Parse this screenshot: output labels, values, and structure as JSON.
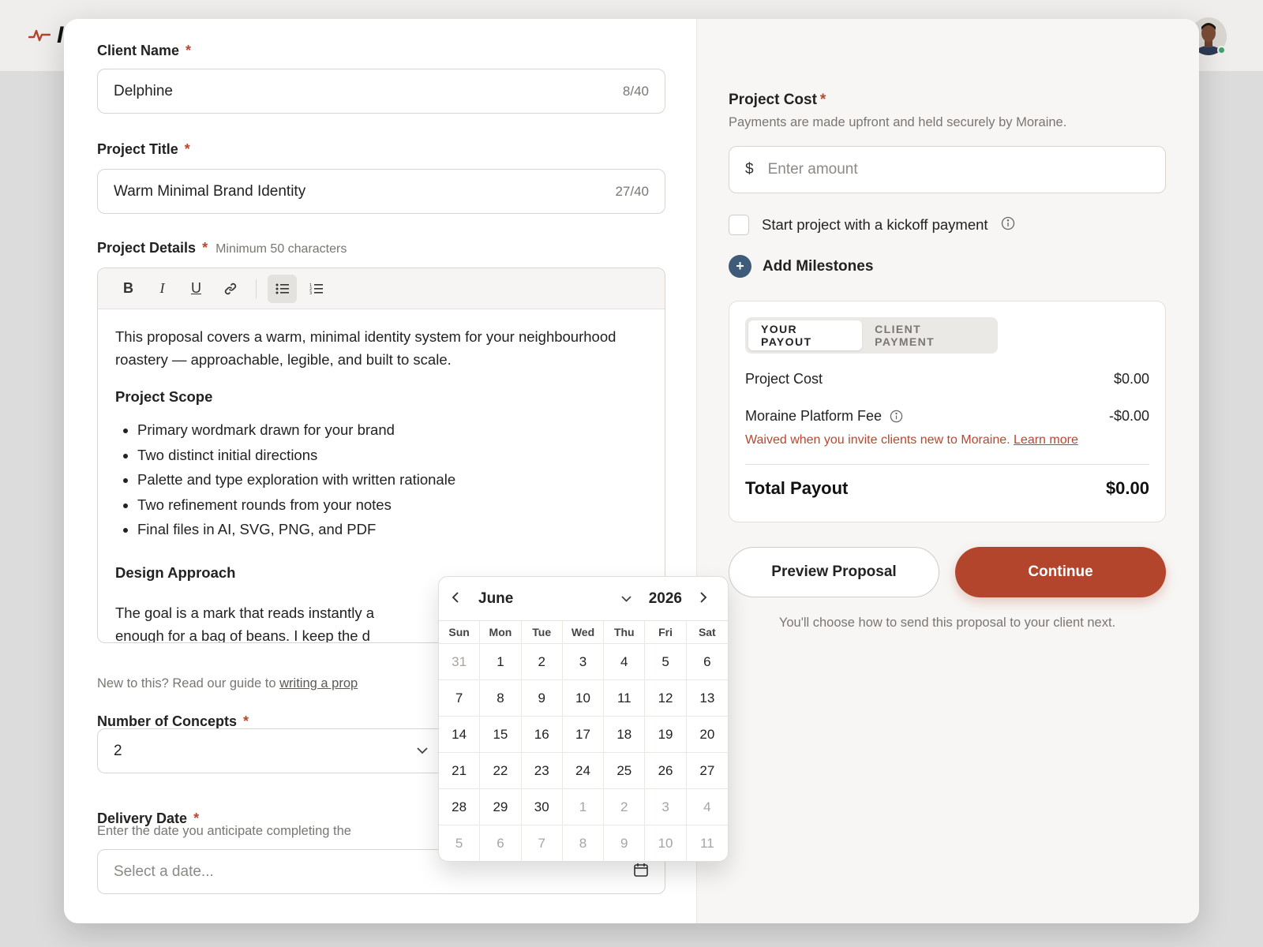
{
  "app": {
    "logo_letter": "I"
  },
  "form": {
    "client_name": {
      "label": "Client Name",
      "value": "Delphine",
      "count": "8/40"
    },
    "project_title": {
      "label": "Project Title",
      "value": "Warm Minimal Brand Identity",
      "count": "27/40"
    },
    "project_details": {
      "label": "Project Details",
      "hint": "Minimum 50 characters",
      "toolbar": [
        "bold",
        "italic",
        "underline",
        "link",
        "bullet-list",
        "numbered-list"
      ],
      "intro": "This proposal covers a warm, minimal identity system for your neighbourhood roastery — approachable, legible, and built to scale.",
      "scope_heading": "Project Scope",
      "scope_items": [
        "Primary wordmark drawn for your brand",
        "Two distinct initial directions",
        "Palette and type exploration with written rationale",
        "Two refinement rounds from your notes",
        "Final files in AI, SVG, PNG, and PDF"
      ],
      "approach_heading": "Design Approach",
      "approach_text": "The goal is a mark that reads instantly a",
      "approach_text_2": "enough for a bag of beans. I keep the d"
    },
    "guide": {
      "prefix": "New to this? Read our guide to ",
      "link": "writing a prop"
    },
    "concepts": {
      "label": "Number of Concepts",
      "value": "2"
    },
    "delivery": {
      "label": "Delivery Date",
      "hint": "Enter the date you anticipate completing the",
      "placeholder": "Select a date..."
    },
    "required_mark": "*"
  },
  "datepicker": {
    "month": "June",
    "year": "2026",
    "weekdays": [
      "Sun",
      "Mon",
      "Tue",
      "Wed",
      "Thu",
      "Fri",
      "Sat"
    ],
    "days": [
      [
        "31",
        true
      ],
      [
        "1",
        false
      ],
      [
        "2",
        false
      ],
      [
        "3",
        false
      ],
      [
        "4",
        false
      ],
      [
        "5",
        false
      ],
      [
        "6",
        false
      ],
      [
        "7",
        false
      ],
      [
        "8",
        false
      ],
      [
        "9",
        false
      ],
      [
        "10",
        false
      ],
      [
        "11",
        false
      ],
      [
        "12",
        false
      ],
      [
        "13",
        false
      ],
      [
        "14",
        false
      ],
      [
        "15",
        false
      ],
      [
        "16",
        false
      ],
      [
        "17",
        false
      ],
      [
        "18",
        false
      ],
      [
        "19",
        false
      ],
      [
        "20",
        false
      ],
      [
        "21",
        false
      ],
      [
        "22",
        false
      ],
      [
        "23",
        false
      ],
      [
        "24",
        false
      ],
      [
        "25",
        false
      ],
      [
        "26",
        false
      ],
      [
        "27",
        false
      ],
      [
        "28",
        false
      ],
      [
        "29",
        false
      ],
      [
        "30",
        false
      ],
      [
        "1",
        true
      ],
      [
        "2",
        true
      ],
      [
        "3",
        true
      ],
      [
        "4",
        true
      ],
      [
        "5",
        true
      ],
      [
        "6",
        true
      ],
      [
        "7",
        true
      ],
      [
        "8",
        true
      ],
      [
        "9",
        true
      ],
      [
        "10",
        true
      ],
      [
        "11",
        true
      ]
    ]
  },
  "cost": {
    "label": "Project Cost",
    "sub": "Payments are made upfront and held securely by Moraine.",
    "currency": "$",
    "placeholder": "Enter amount",
    "kickoff_label": "Start project with a kickoff payment",
    "milestones_label": "Add Milestones"
  },
  "payout": {
    "tabs": [
      "YOUR PAYOUT",
      "CLIENT PAYMENT"
    ],
    "project_cost_label": "Project Cost",
    "project_cost_value": "$0.00",
    "fee_label": "Moraine Platform Fee",
    "fee_value": "-$0.00",
    "note": "Waived when you invite clients new to Moraine. ",
    "note_link": "Learn more",
    "total_label": "Total Payout",
    "total_value": "$0.00"
  },
  "actions": {
    "preview": "Preview Proposal",
    "continue": "Continue",
    "footnote": "You'll choose how to send this proposal to your client next."
  },
  "colors": {
    "accent": "#b3452c",
    "milestone": "#3e5b7a",
    "online": "#3ea36a"
  }
}
